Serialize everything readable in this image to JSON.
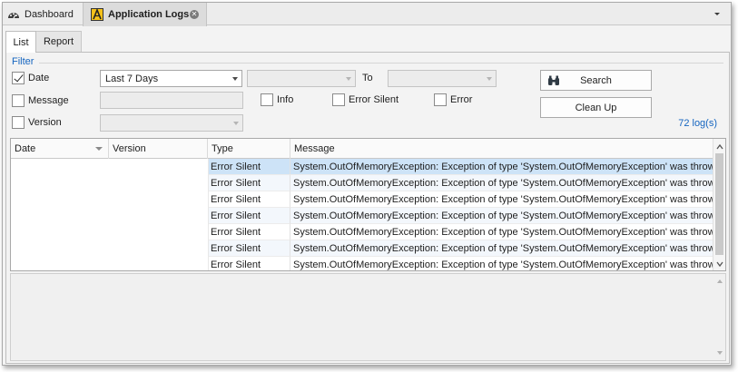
{
  "doc_tabs": [
    {
      "label": "Dashboard",
      "icon": "dashboard-gauge-icon",
      "active": false
    },
    {
      "label": "Application Logs",
      "icon": "application-logs-icon",
      "active": true
    }
  ],
  "sub_tabs": [
    {
      "label": "List",
      "active": true
    },
    {
      "label": "Report",
      "active": false
    }
  ],
  "filter": {
    "title": "Filter",
    "date": {
      "label": "Date",
      "checked": true,
      "range_value": "Last 7 Days",
      "from_value": "",
      "to_label": "To",
      "to_value": ""
    },
    "message": {
      "label": "Message",
      "checked": false,
      "value": ""
    },
    "version": {
      "label": "Version",
      "checked": false,
      "value": ""
    },
    "info": {
      "label": "Info",
      "checked": false
    },
    "error_silent": {
      "label": "Error Silent",
      "checked": false
    },
    "error": {
      "label": "Error",
      "checked": false
    }
  },
  "buttons": {
    "search": "Search",
    "cleanup": "Clean Up"
  },
  "log_count": "72 log(s)",
  "grid": {
    "columns": [
      "Date",
      "Version",
      "Type",
      "Message"
    ],
    "rows": [
      {
        "type": "Error Silent",
        "message": "System.OutOfMemoryException: Exception of type 'System.OutOfMemoryException' was thrown.  r.B..."
      },
      {
        "type": "Error Silent",
        "message": "System.OutOfMemoryException: Exception of type 'System.OutOfMemoryException' was thrown.  r.B..."
      },
      {
        "type": "Error Silent",
        "message": "System.OutOfMemoryException: Exception of type 'System.OutOfMemoryException' was thrown.  r.B..."
      },
      {
        "type": "Error Silent",
        "message": "System.OutOfMemoryException: Exception of type 'System.OutOfMemoryException' was thrown.  te(..."
      },
      {
        "type": "Error Silent",
        "message": "System.OutOfMemoryException: Exception of type 'System.OutOfMemoryException' was thrown.  r.B..."
      },
      {
        "type": "Error Silent",
        "message": "System.OutOfMemoryException: Exception of type 'System.OutOfMemoryException' was thrown.  r.B..."
      },
      {
        "type": "Error Silent",
        "message": "System.OutOfMemoryException: Exception of type 'System.OutOfMemoryException' was thrown.  r.B..."
      }
    ],
    "selected_row": 0
  },
  "colors": {
    "accent": "#1565c0",
    "selected_row": "#cde3f7",
    "alt_row": "#f3f7fc"
  }
}
